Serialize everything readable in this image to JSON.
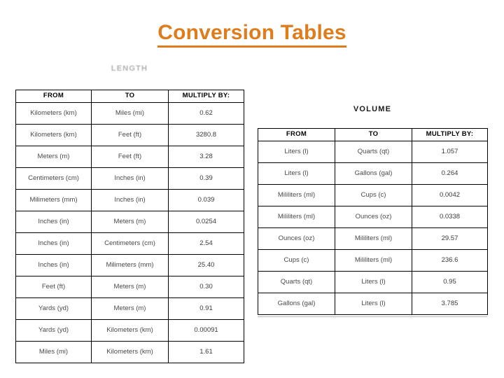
{
  "slide": {
    "title": "Conversion Tables",
    "title_color": "#DE7D1E",
    "background_color": "#FFFFFF"
  },
  "tables": [
    {
      "id": "length",
      "caption": "LENGTH",
      "columns": [
        "FROM",
        "TO",
        "MULTIPLY BY:"
      ],
      "rows": [
        [
          "Kilometers (km)",
          "Miles (mi)",
          "0.62"
        ],
        [
          "Kilometers (km)",
          "Feet (ft)",
          "3280.8"
        ],
        [
          "Meters (m)",
          "Feet (ft)",
          "3.28"
        ],
        [
          "Centimeters (cm)",
          "Inches (in)",
          "0.39"
        ],
        [
          "Milimeters (mm)",
          "Inches (in)",
          "0.039"
        ],
        [
          "Inches (in)",
          "Meters (m)",
          "0.0254"
        ],
        [
          "Inches (in)",
          "Centimeters (cm)",
          "2.54"
        ],
        [
          "Inches (in)",
          "Milimeters (mm)",
          "25.40"
        ],
        [
          "Feet (ft)",
          "Meters (m)",
          "0.30"
        ],
        [
          "Yards (yd)",
          "Meters (m)",
          "0.91"
        ],
        [
          "Yards (yd)",
          "Kilometers (km)",
          "0.00091"
        ],
        [
          "Miles (mi)",
          "Kilometers (km)",
          "1.61"
        ]
      ]
    },
    {
      "id": "volume",
      "caption": "VOLUME",
      "columns": [
        "FROM",
        "TO",
        "MULTIPLY BY:"
      ],
      "rows": [
        [
          "Liters (l)",
          "Quarts (qt)",
          "1.057"
        ],
        [
          "Liters (l)",
          "Gallons (gal)",
          "0.264"
        ],
        [
          "Mililiters (ml)",
          "Cups (c)",
          "0.0042"
        ],
        [
          "Mililiters (ml)",
          "Ounces (oz)",
          "0.0338"
        ],
        [
          "Ounces (oz)",
          "Mililiters (ml)",
          "29.57"
        ],
        [
          "Cups (c)",
          "Mililiters (ml)",
          "236.6"
        ],
        [
          "Quarts (qt)",
          "Liters (l)",
          "0.95"
        ],
        [
          "Gallons (gal)",
          "Liters (l)",
          "3.785"
        ]
      ]
    }
  ]
}
